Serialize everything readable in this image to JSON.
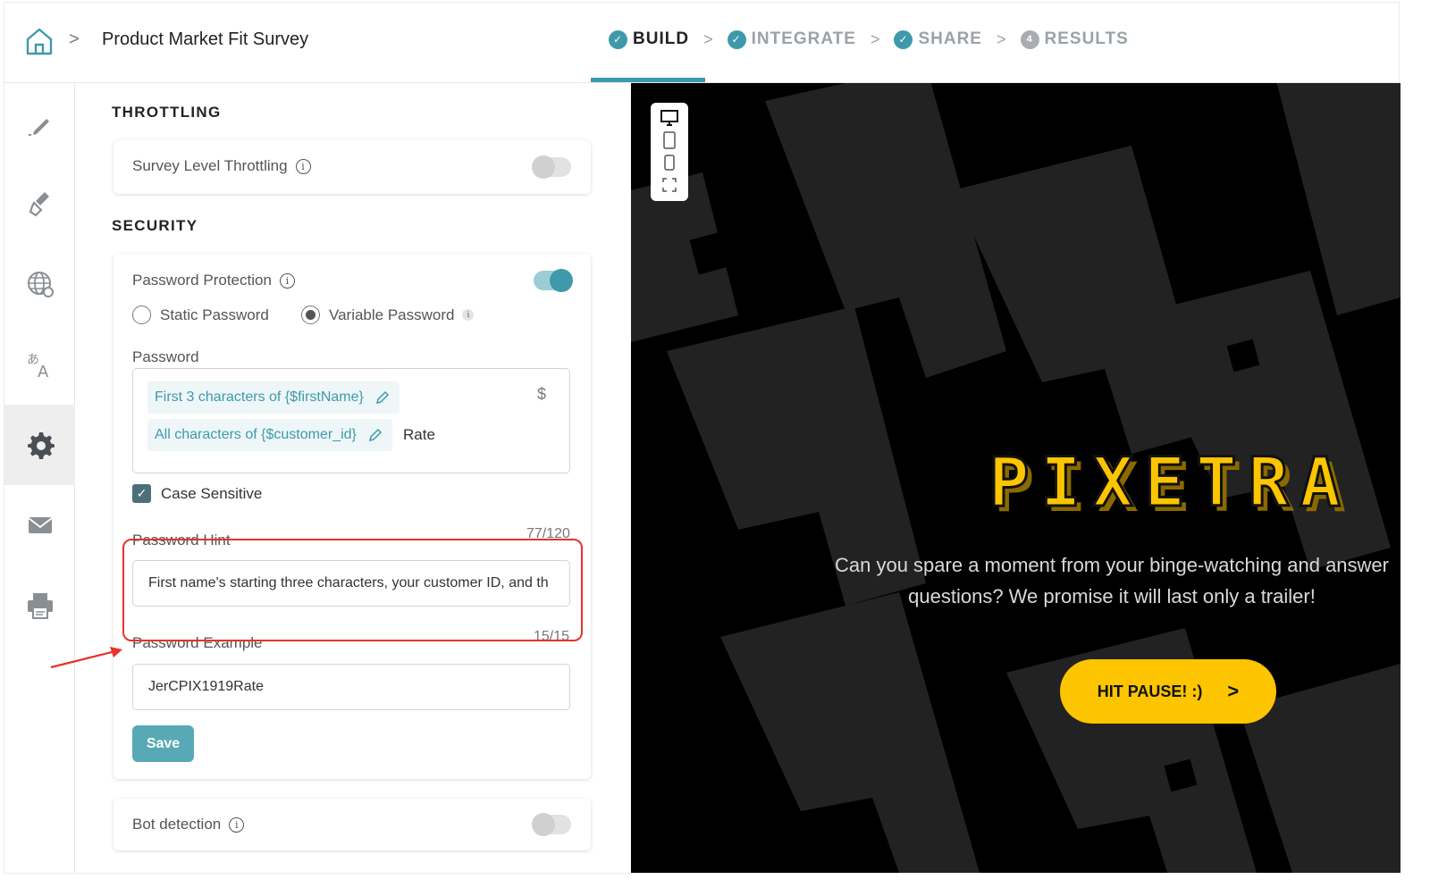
{
  "header": {
    "breadcrumb_separator": ">",
    "survey_title": "Product Market Fit Survey",
    "steps": [
      {
        "label": "BUILD",
        "state": "active",
        "marker": "check"
      },
      {
        "label": "INTEGRATE",
        "state": "done",
        "marker": "check"
      },
      {
        "label": "SHARE",
        "state": "done",
        "marker": "check"
      },
      {
        "label": "RESULTS",
        "state": "pending",
        "marker": "4"
      }
    ],
    "step_separator": ">"
  },
  "rail": {
    "items": [
      {
        "icon": "pencil-icon",
        "active": false
      },
      {
        "icon": "paint-brush-icon",
        "active": false
      },
      {
        "icon": "globe-icon",
        "active": false
      },
      {
        "icon": "translate-icon",
        "active": false
      },
      {
        "icon": "gear-icon",
        "active": true
      },
      {
        "icon": "envelope-icon",
        "active": false
      },
      {
        "icon": "printer-icon",
        "active": false
      }
    ]
  },
  "settings": {
    "throttling_title": "THROTTLING",
    "survey_level_throttling": {
      "label": "Survey Level Throttling",
      "enabled": false
    },
    "security_title": "SECURITY",
    "password_protection": {
      "label": "Password Protection",
      "enabled": true,
      "static_option": "Static Password",
      "variable_option": "Variable Password",
      "selected": "Variable Password",
      "password_label": "Password",
      "chip_1": "First 3 characters of {$firstName}",
      "chip_2": "All characters of {$customer_id}",
      "trailing_text": "Rate",
      "dollar_symbol": "$",
      "case_sensitive_label": "Case Sensitive",
      "case_sensitive": true,
      "hint_label": "Password Hint",
      "hint_counter": "77/120",
      "hint_value": "First name's starting three characters, your customer ID, and th",
      "example_label": "Password Example",
      "example_counter": "15/15",
      "example_value": "JerCPIX1919Rate",
      "save_label": "Save"
    },
    "bot_detection": {
      "label": "Bot detection",
      "enabled": false
    }
  },
  "colors": {
    "accent": "#3e9aab",
    "highlight": "#e8322b",
    "cta": "#fdc500",
    "preview_bg": "#000000"
  },
  "preview": {
    "device_options": [
      "desktop-icon",
      "tablet-icon",
      "mobile-icon",
      "fullscreen-icon"
    ],
    "brand_logo": "PIXETRA",
    "tagline_line1": "Can you spare a moment from your binge-watching and answer",
    "tagline_line2": "questions? We promise it will last only a trailer!",
    "cta_label": "HIT PAUSE! :)",
    "cta_chevron": ">"
  }
}
